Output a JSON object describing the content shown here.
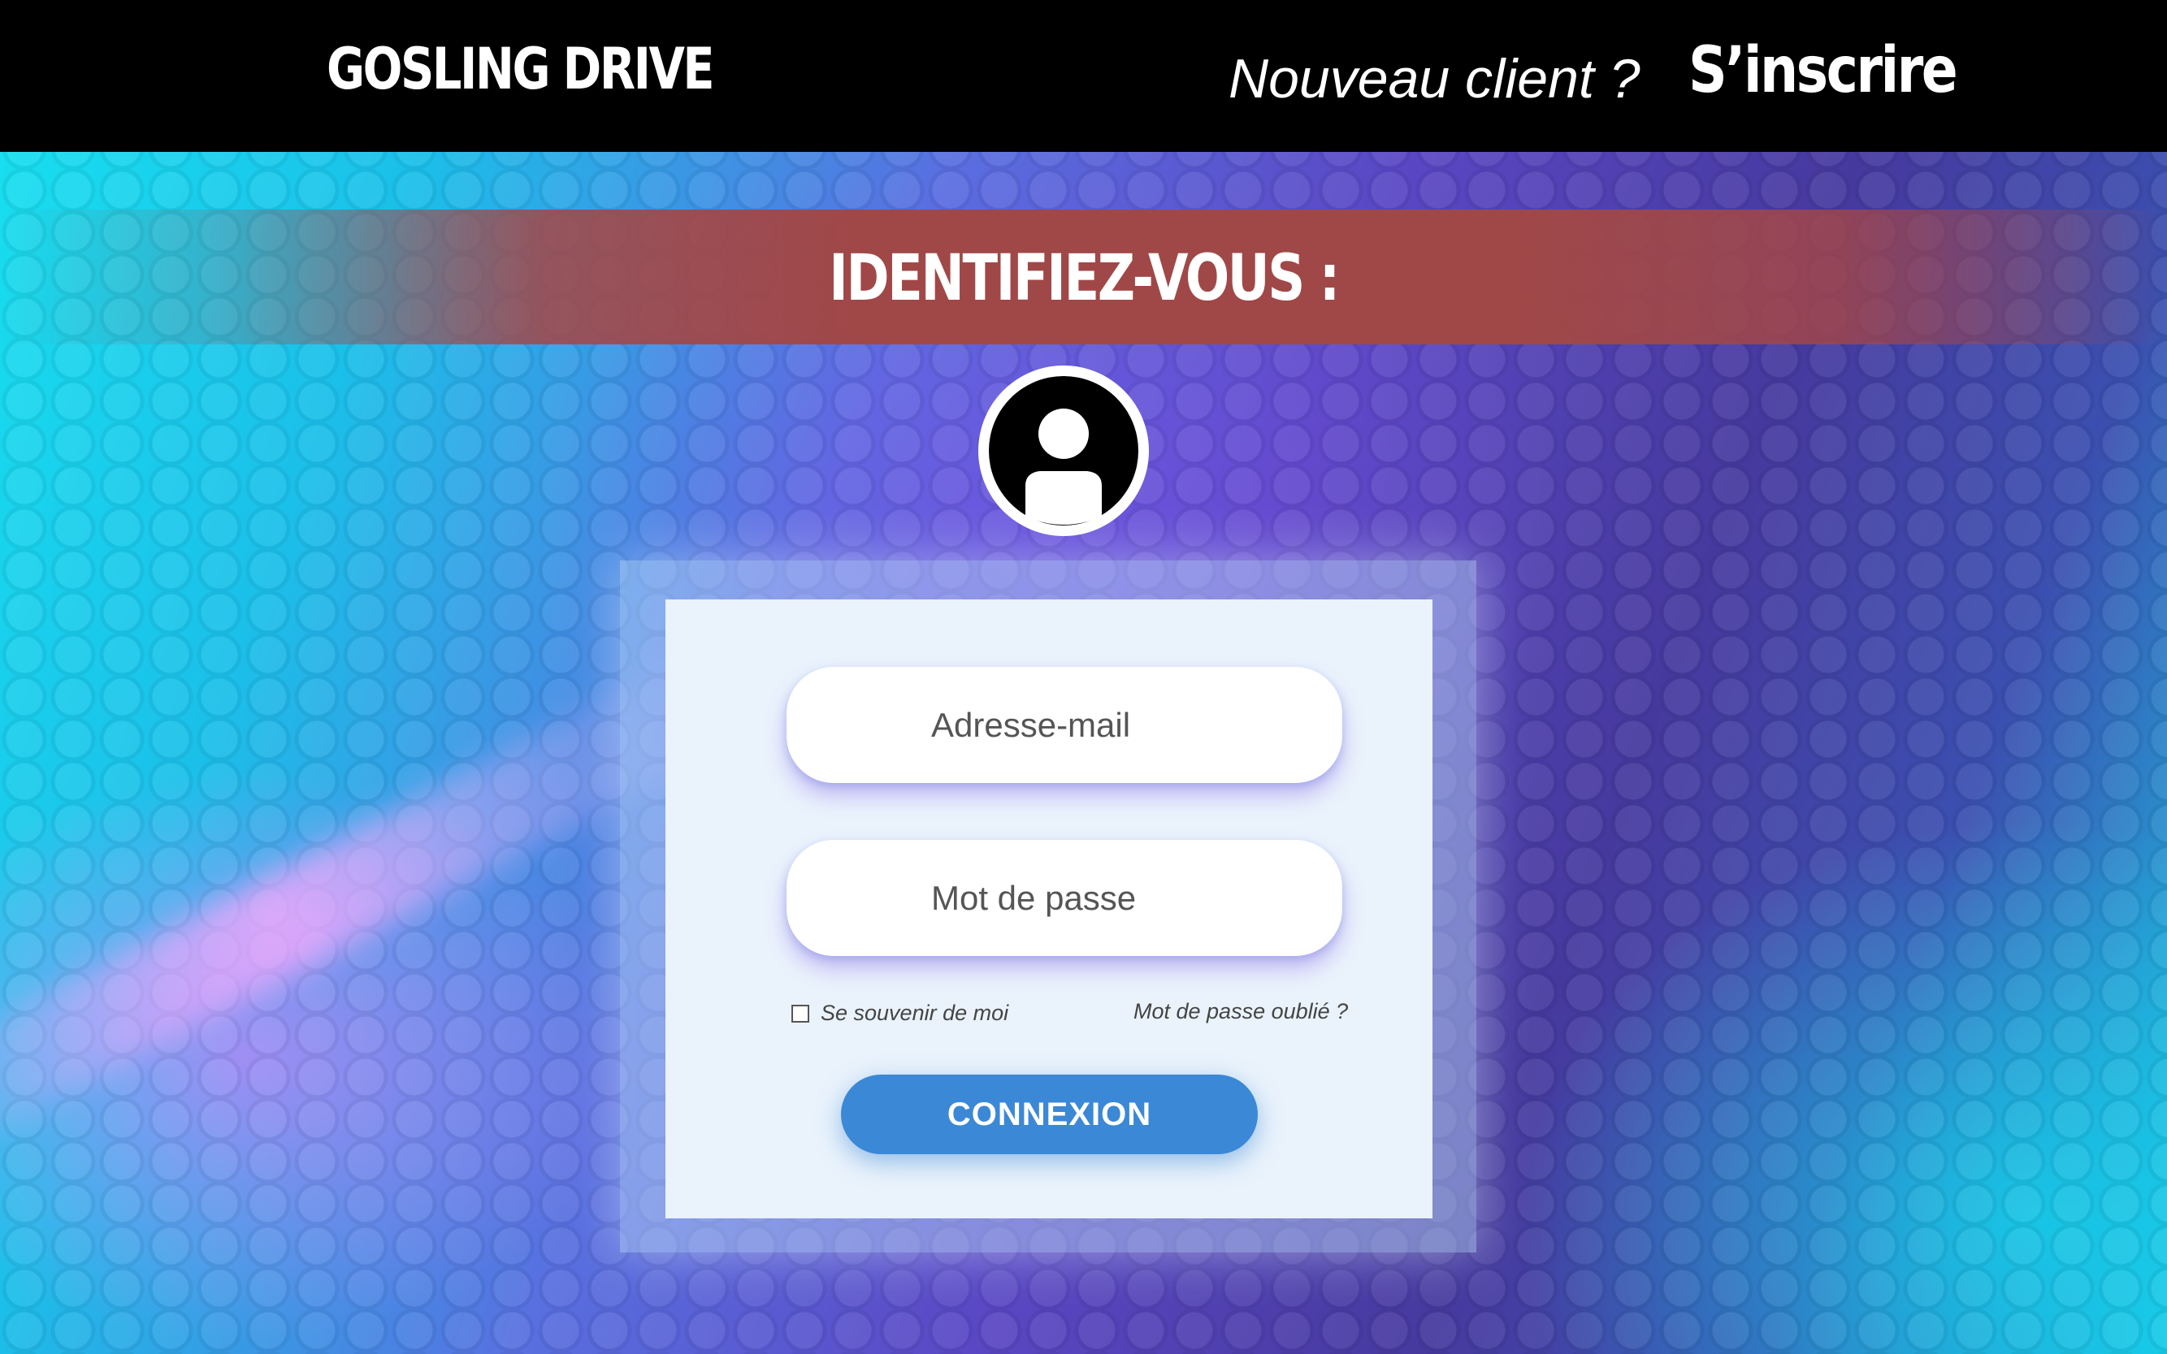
{
  "header": {
    "brand": "GOSLING DRIVE",
    "new_client": "Nouveau client ?",
    "signup": "S’inscrire"
  },
  "banner": {
    "title": "IDENTIFIEZ-VOUS :"
  },
  "avatar": {
    "icon": "user-avatar-icon"
  },
  "form": {
    "email_placeholder": "Adresse-mail",
    "password_placeholder": "Mot de passe",
    "remember_label": "Se souvenir de moi",
    "remember_checked": false,
    "forgot_link": "Mot de passe oublié ?",
    "submit_label": "CONNEXION"
  },
  "colors": {
    "topbar": "#000000",
    "banner": "#a04848",
    "button": "#3b88d6",
    "card": "#eaf3fc"
  }
}
